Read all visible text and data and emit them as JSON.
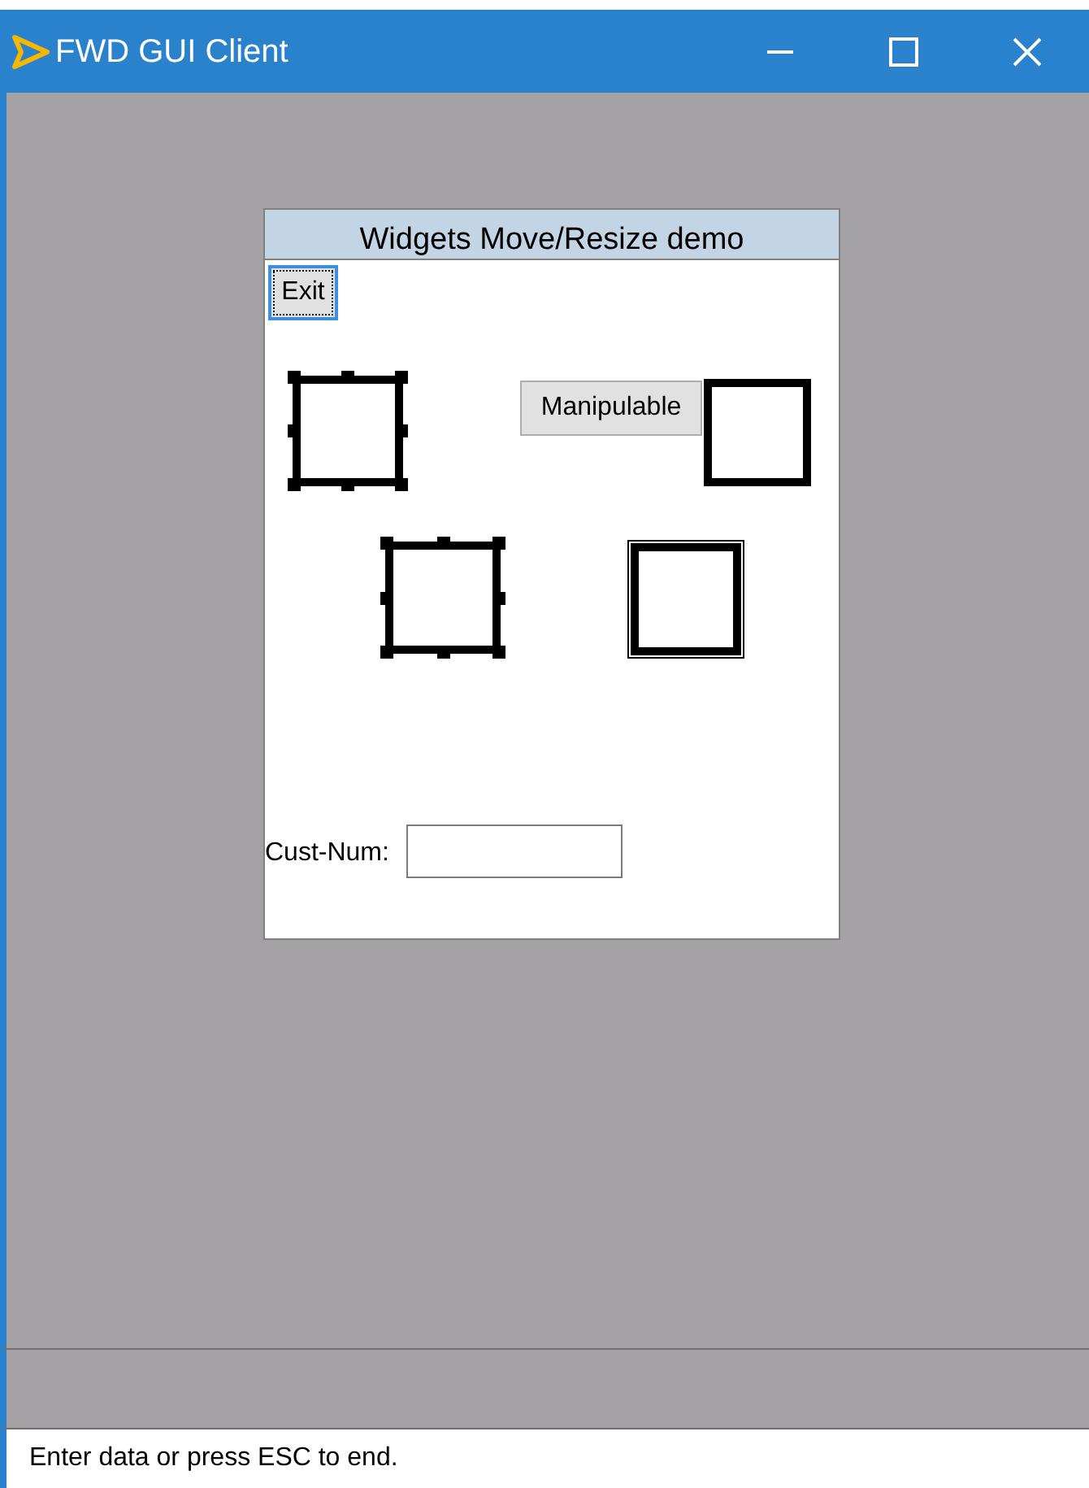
{
  "window": {
    "title": "FWD GUI Client"
  },
  "frame": {
    "title": "Widgets Move/Resize demo",
    "exit_button": {
      "label": "Exit",
      "focused": true
    },
    "manipulable_button": {
      "label": "Manipulable"
    },
    "shapes": [
      {
        "kind": "selected"
      },
      {
        "kind": "plain"
      },
      {
        "kind": "selected"
      },
      {
        "kind": "double"
      }
    ],
    "cust_num": {
      "label": "Cust-Num:"
    }
  },
  "status_bar": {
    "message": "Enter data or press ESC to end."
  }
}
